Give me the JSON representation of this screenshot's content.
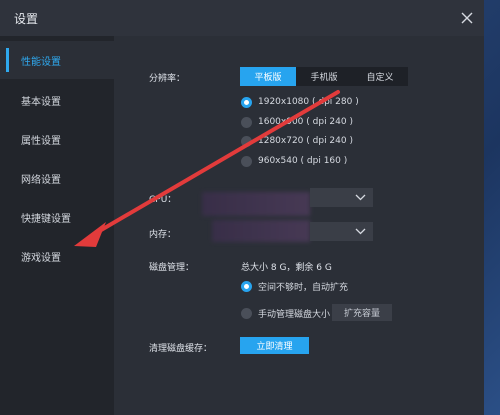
{
  "window": {
    "title": "设置"
  },
  "sidebar": {
    "items": [
      {
        "label": "性能设置",
        "active": true
      },
      {
        "label": "基本设置"
      },
      {
        "label": "属性设置"
      },
      {
        "label": "网络设置"
      },
      {
        "label": "快捷键设置"
      },
      {
        "label": "游戏设置"
      }
    ]
  },
  "resolution": {
    "label": "分辨率：",
    "tabs": [
      "平板版",
      "手机版",
      "自定义"
    ],
    "selected_tab": "平板版",
    "options": [
      "1920x1080 ( dpi 280 )",
      "1600x900 ( dpi 240 )",
      "1280x720 ( dpi 240 )",
      "960x540 ( dpi 160 )"
    ],
    "selected_option": "1920x1080 ( dpi 280 )"
  },
  "cpu": {
    "label": "CPU："
  },
  "memory": {
    "label": "内存："
  },
  "disk": {
    "label": "磁盘管理：",
    "summary": "总大小 8 G，剩余 6 G",
    "auto_option": "空间不够时，自动扩充",
    "manual_option": "手动管理磁盘大小",
    "expand_button": "扩充容量"
  },
  "cache": {
    "label": "清理磁盘缓存：",
    "button": "立即清理"
  },
  "colors": {
    "accent": "#27a4ef",
    "annotation_arrow": "#e23b3b"
  },
  "icons": {
    "close": "close-icon",
    "dropdown": "chevron-down-icon"
  }
}
